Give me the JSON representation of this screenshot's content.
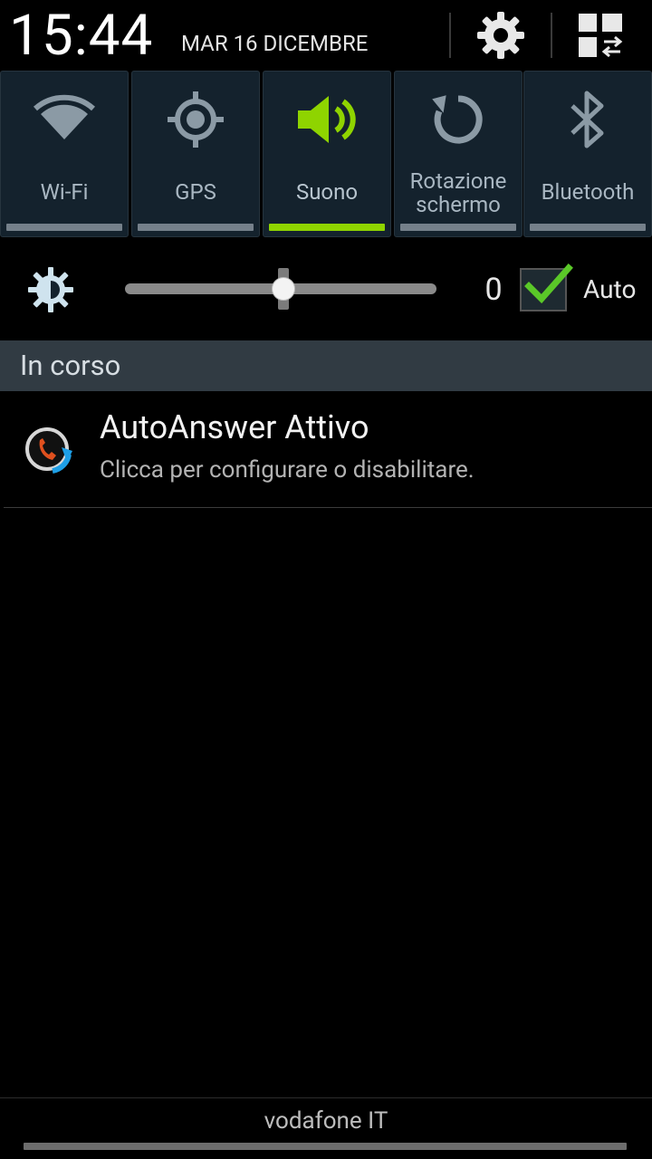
{
  "status": {
    "time": "15:44",
    "date": "MAR 16 DICEMBRE"
  },
  "header_icons": {
    "settings": "gear-icon",
    "edit_toggles": "grid-swap-icon"
  },
  "quick_toggles": [
    {
      "label": "Wi-Fi",
      "icon": "wifi-icon",
      "state": "off"
    },
    {
      "label": "GPS",
      "icon": "gps-icon",
      "state": "off"
    },
    {
      "label": "Suono",
      "icon": "sound-icon",
      "state": "on"
    },
    {
      "label_line1": "Rotazione",
      "label_line2": "schermo",
      "icon": "rotation-icon",
      "state": "off"
    },
    {
      "label": "Bluetooth",
      "icon": "bluetooth-icon",
      "state": "off"
    }
  ],
  "brightness": {
    "value": "0",
    "level": 0.5,
    "auto_label": "Auto",
    "auto_checked": true
  },
  "ongoing": {
    "section_title": "In corso",
    "notification": {
      "title": "AutoAnswer Attivo",
      "text": "Clicca per configurare o disabilitare."
    }
  },
  "carrier": "vodafone IT",
  "colors": {
    "accent_green": "#8fd400",
    "toggle_bg": "#14222d",
    "section_bg": "#313b43"
  }
}
